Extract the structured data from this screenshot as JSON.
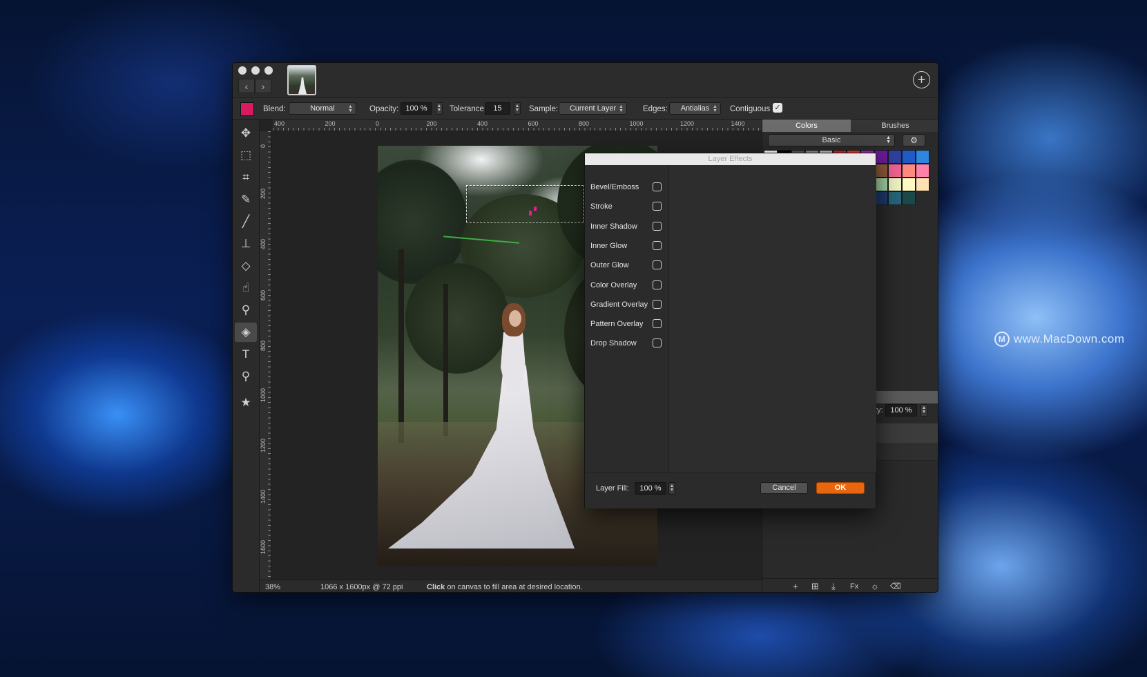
{
  "watermark": {
    "logo": "M",
    "text": "www.MacDown.com"
  },
  "toolbar_top": {
    "nav_back": "‹",
    "nav_forward": "›",
    "add_document": "+"
  },
  "options": {
    "primary_color": "#d81b60",
    "blend_label": "Blend:",
    "blend_value": "Normal",
    "opacity_label": "Opacity:",
    "opacity_value": "100 %",
    "tolerance_label": "Tolerance:",
    "tolerance_value": "15",
    "sample_label": "Sample:",
    "sample_value": "Current Layer",
    "edges_label": "Edges:",
    "edges_value": "Antialias",
    "contiguous_label": "Contiguous",
    "contiguous_checked": true,
    "contiguous_mark": "✓"
  },
  "tools": [
    {
      "name": "move-tool",
      "glyph": "✥"
    },
    {
      "name": "marquee-tool",
      "glyph": "⬚"
    },
    {
      "name": "crop-tool",
      "glyph": "⌗"
    },
    {
      "name": "eyedropper-tool",
      "glyph": "✎"
    },
    {
      "name": "brush-tool",
      "glyph": "╱"
    },
    {
      "name": "stamp-tool",
      "glyph": "⊥"
    },
    {
      "name": "eraser-tool",
      "glyph": "◇"
    },
    {
      "name": "smudge-tool",
      "glyph": "☝"
    },
    {
      "name": "dodge-tool",
      "glyph": "⚲"
    },
    {
      "name": "paint-bucket-tool",
      "glyph": "◈",
      "active": true
    },
    {
      "name": "text-tool",
      "glyph": "T"
    },
    {
      "name": "zoom-tool",
      "glyph": "⚲"
    },
    {
      "name": "favorites-tool",
      "glyph": "★"
    }
  ],
  "ruler": {
    "h_ticks": [
      "400",
      "200",
      "0",
      "200",
      "400",
      "600",
      "800",
      "1000",
      "1200",
      "1400"
    ],
    "v_ticks": [
      "0",
      "200",
      "400",
      "600",
      "800",
      "1000",
      "1200",
      "1400",
      "1600"
    ]
  },
  "status": {
    "zoom": "38%",
    "dimensions": "1066 x 1600px @ 72 ppi",
    "hint_bold": "Click",
    "hint_rest": " on canvas to fill area at desired location."
  },
  "right_panel": {
    "tabs": [
      "Colors",
      "Brushes"
    ],
    "active_tab": "Colors",
    "palette": "Basic",
    "gear": "⚙",
    "swatches": [
      [
        "#ffffff",
        "#000000",
        "#555555",
        "#888888",
        "#bbbbbb",
        "#c62828",
        "#e53935",
        "#9c27b0",
        "#6a1b9a",
        "#303f9f",
        "#1e5bc6",
        "#2e86de"
      ],
      [
        "#ff9800",
        "#f4511e",
        "#8d5a3b",
        "#f06292",
        "#ff8a80",
        "#ff80ab"
      ],
      [
        "#4caf50",
        "#a5d6a7",
        "#f0f4c3",
        "#fff9c4",
        "#ffe0b2"
      ],
      [
        "#1a237e",
        "#1e3a6e",
        "#26657a",
        "#1c4a4a"
      ]
    ],
    "opacity_label": "city:",
    "opacity_value": "100 %",
    "footer_icons": [
      "+",
      "⊞",
      "⤓",
      "Fx",
      "☼",
      "🗑"
    ]
  },
  "dialog": {
    "title": "Layer Effects",
    "effects": [
      {
        "label": "Bevel/Emboss",
        "checked": false
      },
      {
        "label": "Stroke",
        "checked": false
      },
      {
        "label": "Inner Shadow",
        "checked": false
      },
      {
        "label": "Inner Glow",
        "checked": false
      },
      {
        "label": "Outer Glow",
        "checked": false
      },
      {
        "label": "Color Overlay",
        "checked": false
      },
      {
        "label": "Gradient Overlay",
        "checked": false
      },
      {
        "label": "Pattern Overlay",
        "checked": false
      },
      {
        "label": "Drop Shadow",
        "checked": false
      }
    ],
    "layer_fill_label": "Layer Fill:",
    "layer_fill_value": "100 %",
    "cancel": "Cancel",
    "ok": "OK",
    "ok_color": "#e8660d"
  }
}
